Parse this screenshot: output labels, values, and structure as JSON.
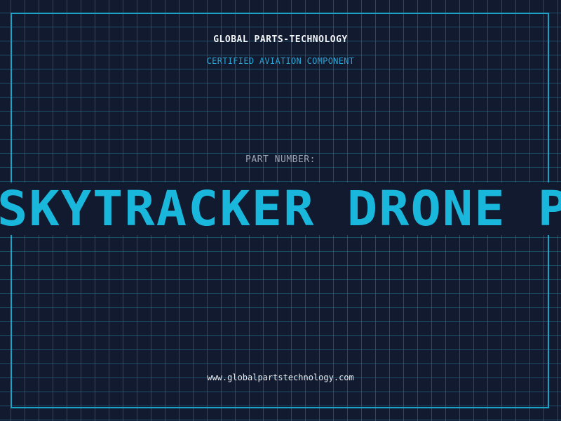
{
  "header": {
    "company": "GLOBAL PARTS-TECHNOLOGY",
    "subtitle": "CERTIFIED AVIATION COMPONENT"
  },
  "part": {
    "label": "PART NUMBER:",
    "name": "SKYTRACKER DRONE P"
  },
  "footer": {
    "website": "www.globalpartstechnology.com"
  },
  "colors": {
    "background": "#111a2e",
    "grid": "#26788c",
    "accent": "#19b7dc",
    "frame": "#1aa3c7",
    "label": "#9aa3b4",
    "text": "#f2f4f7"
  }
}
